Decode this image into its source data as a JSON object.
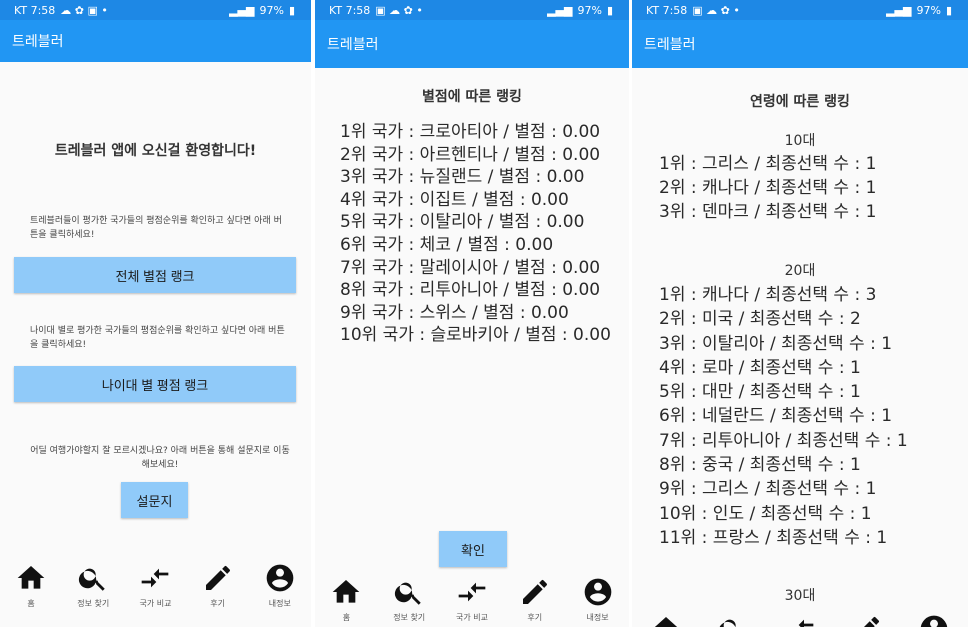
{
  "status": {
    "screen1": {
      "carrier": "KT 7:58",
      "icons_left": "☁ ✿ ▣ •",
      "battery": "97%"
    },
    "screen2": {
      "carrier": "KT 7:58",
      "icons_left": "▣ ☁ ✿ •",
      "battery": "97%"
    },
    "screen3": {
      "carrier": "KT 7:58",
      "icons_left": "▣ ☁ ✿ •",
      "battery": "97%"
    }
  },
  "app_title": "트레블러",
  "home": {
    "welcome": "트레블러 앱에 오신걸 환영합니다!",
    "desc1": "트레블러들이 평가한 국가들의 평점순위를 확인하고 싶다면 아래 버튼을 클릭하세요!",
    "btn_overall": "전체 별점 랭크",
    "desc2": "나이대 별로 평가한 국가들의 평점순위를 확인하고 싶다면 아래 버튼을 클릭하세요!",
    "btn_age": "나이대 별 평점 랭크",
    "desc3": "어딜 여행가야할지 잘 모르시겠나요? 아래 버튼을 통해 설문지로 이동해보세요!",
    "btn_survey": "설문지"
  },
  "nav": [
    {
      "label": "홈",
      "icon": "home-icon"
    },
    {
      "label": "정보 찾기",
      "icon": "search-icon"
    },
    {
      "label": "국가 비교",
      "icon": "compare-arrows-icon"
    },
    {
      "label": "후기",
      "icon": "edit-icon"
    },
    {
      "label": "내정보",
      "icon": "account-icon"
    }
  ],
  "rating_rank": {
    "title": "별점에 따른 랭킹",
    "items": [
      "1위 국가 : 크로아티아 / 별점 : 0.00",
      "2위 국가 : 아르헨티나 / 별점 : 0.00",
      "3위 국가 : 뉴질랜드 / 별점 : 0.00",
      "4위 국가 : 이집트 / 별점 : 0.00",
      "5위 국가 : 이탈리아 / 별점 : 0.00",
      "6위 국가 : 체코 / 별점 : 0.00",
      "7위 국가 : 말레이시아 / 별점 : 0.00",
      "8위 국가 : 리투아니아 / 별점 : 0.00",
      "9위 국가 : 스위스 / 별점 : 0.00",
      "10위 국가 : 슬로바키아 / 별점 : 0.00"
    ],
    "confirm": "확인"
  },
  "age_rank": {
    "title": "연령에 따른 랭킹",
    "group10": {
      "label": "10대",
      "items": [
        "1위 : 그리스 / 최종선택 수 : 1",
        "2위 : 캐나다 / 최종선택 수 : 1",
        "3위 : 덴마크 / 최종선택 수 : 1"
      ]
    },
    "group20": {
      "label": "20대",
      "items": [
        "1위 : 캐나다 / 최종선택 수 : 3",
        "2위 : 미국 / 최종선택 수 : 2",
        "3위 : 이탈리아 / 최종선택 수 : 1",
        "4위 : 로마 / 최종선택 수 : 1",
        "5위 : 대만 / 최종선택 수 : 1",
        "6위 : 네덜란드 / 최종선택 수 : 1",
        "7위 : 리투아니아 / 최종선택 수 : 1",
        "8위 : 중국 / 최종선택 수 : 1",
        "9위 : 그리스 / 최종선택 수 : 1",
        "10위 : 인도 / 최종선택 수 : 1",
        "11위 : 프랑스 / 최종선택 수 : 1"
      ]
    },
    "group30": {
      "label": "30대"
    }
  },
  "colors": {
    "statusbar": "#1e88e5",
    "appbar": "#2196f3",
    "button": "#90caf9"
  }
}
